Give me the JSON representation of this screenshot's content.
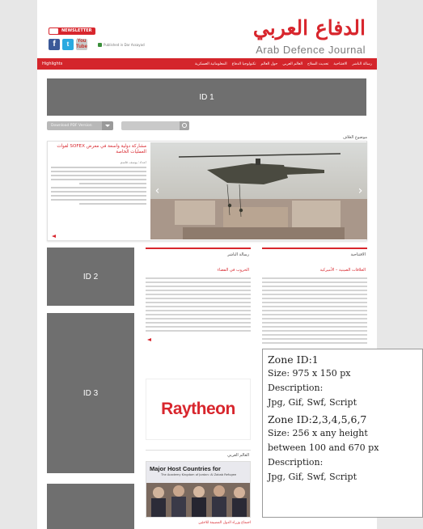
{
  "header": {
    "newsletter_label": "NEWSLETTER",
    "published_text": "Published in Dar Assayad",
    "brand_arabic": "الدفاع العربي",
    "brand_english": "Arab Defence Journal"
  },
  "nav": {
    "highlights": "Highlights",
    "items": [
      "رسالة الناشر",
      "الافتتاحية",
      "تحديث السلاح",
      "العالم العربي",
      "حول العالم",
      "تكنولوجيا الدفاع",
      "المعلوماتية العسكرية"
    ]
  },
  "zones_placeholders": {
    "zone1_label": "ID 1",
    "zone2_label": "ID 2",
    "zone3_label": "ID 3"
  },
  "toolbar": {
    "pdf_label": "Download PDF Version"
  },
  "featured": {
    "section_label": "موضوع الغلاف",
    "title": "مشاركة دولية واسعة في معرض SOFEX لقوات العمليات الخاصة",
    "byline": "اعداد: يوسف قاسم"
  },
  "columns": {
    "right_title": "الافتتاحية",
    "right_subtitle": "العلاقات الصينية – الأميركية",
    "middle_title": "رسالة الناشر",
    "middle_subtitle": "الحروب في الفضاء",
    "arab_world_title": "العالم العربي",
    "raytheon_text": "Raytheon"
  },
  "thumb": {
    "headline": "Major Host Countries for",
    "subline": "The Academy Kingdom of Jordan: Al Zabab Refugee",
    "caption": "اجتماع وزراء الدول المضيفة للاجئين"
  },
  "zone_info": {
    "zone1_title": "Zone ID:1",
    "zone1_size": "Size: 975 x 150 px",
    "zone1_desc_label": "Description:",
    "zone1_desc": "Jpg, Gif, Swf, Script",
    "zone2_title": "Zone ID:2,3,4,5,6,7",
    "zone2_size": "Size: 256 x any height",
    "zone2_size2": "between 100 and 670 px",
    "zone2_desc_label": "Description:",
    "zone2_desc": "Jpg, Gif, Swf, Script"
  },
  "colors": {
    "brand_red": "#d8262d",
    "placeholder_gray": "#6f6f6f"
  }
}
